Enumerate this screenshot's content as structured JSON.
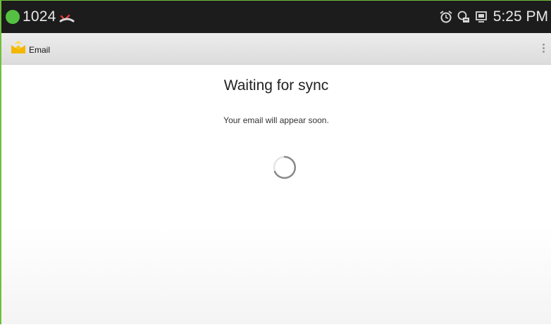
{
  "statusbar": {
    "counter": "1024",
    "time": "5:25 PM",
    "icons": [
      "notification-dot-icon",
      "missed-call-icon",
      "alarm-icon",
      "sync-icon",
      "screen-icon"
    ]
  },
  "actionbar": {
    "title": "Email",
    "icons": [
      "email-app-icon",
      "overflow-menu-icon"
    ]
  },
  "main": {
    "title": "Waiting for sync",
    "subtitle": "Your email will appear soon."
  },
  "colors": {
    "frame_border": "#6fbf3a",
    "status_dot": "#55c142",
    "statusbar_bg": "#1c1c1c"
  }
}
